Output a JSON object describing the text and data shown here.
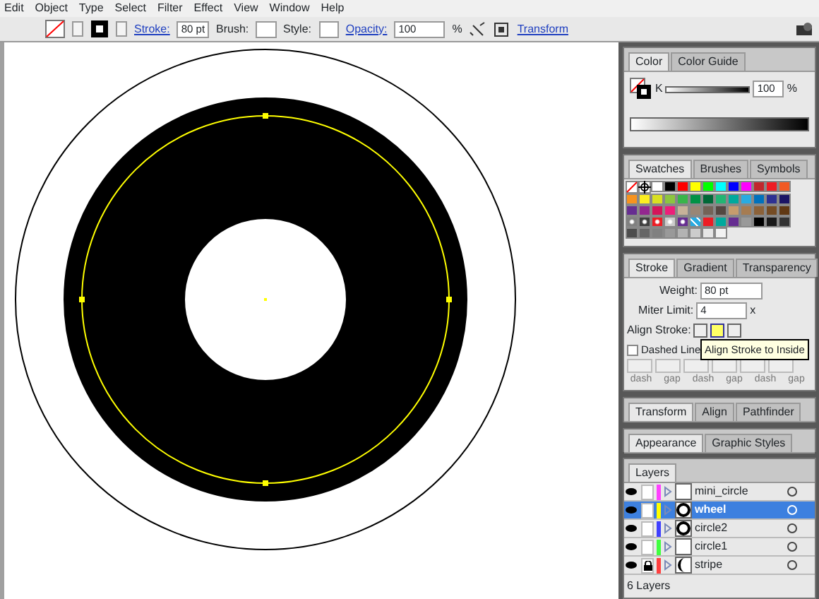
{
  "menu": [
    "Edit",
    "Object",
    "Type",
    "Select",
    "Filter",
    "Effect",
    "View",
    "Window",
    "Help"
  ],
  "control_bar": {
    "stroke_label": "Stroke:",
    "stroke_weight": "80 pt",
    "brush_label": "Brush:",
    "style_label": "Style:",
    "opacity_label": "Opacity:",
    "opacity": "100",
    "percent": "%",
    "transform": "Transform"
  },
  "color_panel": {
    "tabs": [
      {
        "label": "Color",
        "selected": true
      },
      {
        "label": "Color Guide",
        "selected": false
      }
    ],
    "channel": "K",
    "level": 1,
    "value": "100",
    "unit": "%"
  },
  "swatches_panel": {
    "tabs": [
      {
        "label": "Swatches",
        "selected": true
      },
      {
        "label": "Brushes",
        "selected": false
      },
      {
        "label": "Symbols",
        "selected": false
      }
    ],
    "swatches": [
      {
        "kind": "none"
      },
      {
        "kind": "registration"
      },
      {
        "kind": "color",
        "color": "#ffffff"
      },
      {
        "kind": "color",
        "color": "#000000"
      },
      {
        "kind": "color",
        "color": "#ff0000"
      },
      {
        "kind": "color",
        "color": "#ffff00"
      },
      {
        "kind": "color",
        "color": "#00ff00"
      },
      {
        "kind": "color",
        "color": "#00ffff"
      },
      {
        "kind": "color",
        "color": "#0000ff"
      },
      {
        "kind": "color",
        "color": "#ff00ff"
      },
      {
        "kind": "color",
        "color": "#c1272d"
      },
      {
        "kind": "color",
        "color": "#ed1c24"
      },
      {
        "kind": "color",
        "color": "#f15a24"
      },
      {
        "kind": "color",
        "color": "#f7931e"
      },
      {
        "kind": "color",
        "color": "#fcee21"
      },
      {
        "kind": "color",
        "color": "#d9e021"
      },
      {
        "kind": "color",
        "color": "#8cc63f"
      },
      {
        "kind": "color",
        "color": "#39b54a"
      },
      {
        "kind": "color",
        "color": "#009245"
      },
      {
        "kind": "color",
        "color": "#006837"
      },
      {
        "kind": "color",
        "color": "#22b573"
      },
      {
        "kind": "color",
        "color": "#00a99d"
      },
      {
        "kind": "color",
        "color": "#29abe2"
      },
      {
        "kind": "color",
        "color": "#0071bc"
      },
      {
        "kind": "color",
        "color": "#2e3192"
      },
      {
        "kind": "color",
        "color": "#1b1464"
      },
      {
        "kind": "color",
        "color": "#662d91"
      },
      {
        "kind": "color",
        "color": "#93278f"
      },
      {
        "kind": "color",
        "color": "#d4145a"
      },
      {
        "kind": "color",
        "color": "#ed1e79"
      },
      {
        "kind": "color",
        "color": "#c7b299"
      },
      {
        "kind": "color",
        "color": "#998675"
      },
      {
        "kind": "color",
        "color": "#736357"
      },
      {
        "kind": "color",
        "color": "#534741"
      },
      {
        "kind": "color",
        "color": "#c69c6d"
      },
      {
        "kind": "color",
        "color": "#a67c52"
      },
      {
        "kind": "color",
        "color": "#8c6239"
      },
      {
        "kind": "color",
        "color": "#754c24"
      },
      {
        "kind": "color",
        "color": "#603813"
      },
      {
        "kind": "gradient",
        "color": "#808080"
      },
      {
        "kind": "gradient",
        "color": "#404040"
      },
      {
        "kind": "gradient",
        "color": "#ed1c24"
      },
      {
        "kind": "gradient",
        "color": "#cccccc"
      },
      {
        "kind": "gradient",
        "color": "#662d91"
      },
      {
        "kind": "pattern",
        "color": "#29abe2"
      },
      {
        "kind": "color",
        "color": "#ed1c24"
      },
      {
        "kind": "color",
        "color": "#00a99d"
      },
      {
        "kind": "color",
        "color": "#662d91"
      },
      {
        "kind": "color",
        "color": "#999999"
      },
      {
        "kind": "color",
        "color": "#000000"
      },
      {
        "kind": "color",
        "color": "#1a1a1a"
      },
      {
        "kind": "color",
        "color": "#333333"
      },
      {
        "kind": "color",
        "color": "#4d4d4d"
      },
      {
        "kind": "color",
        "color": "#666666"
      },
      {
        "kind": "color",
        "color": "#808080"
      },
      {
        "kind": "color",
        "color": "#999999"
      },
      {
        "kind": "color",
        "color": "#b3b3b3"
      },
      {
        "kind": "color",
        "color": "#cccccc"
      },
      {
        "kind": "color",
        "color": "#e6e6e6"
      },
      {
        "kind": "color",
        "color": "#f2f2f2"
      }
    ]
  },
  "stroke_panel": {
    "tabs": [
      {
        "label": "Stroke",
        "selected": true
      },
      {
        "label": "Gradient",
        "selected": false
      },
      {
        "label": "Transparency",
        "selected": false
      }
    ],
    "weight_label": "Weight:",
    "weight": "80 pt",
    "miter_label": "Miter Limit:",
    "miter": "4",
    "miter_unit": "x",
    "align_label": "Align Stroke:",
    "align_buttons": [
      {
        "selected": false
      },
      {
        "selected": true
      },
      {
        "selected": false
      }
    ],
    "dashed": {
      "label": "Dashed Line",
      "checked": false
    },
    "dash_labels": [
      "dash",
      "gap",
      "dash",
      "gap",
      "dash",
      "gap"
    ],
    "tooltip": "Align Stroke to Inside"
  },
  "transform_panel": {
    "tabs": [
      {
        "label": "Transform",
        "selected": true
      },
      {
        "label": "Align",
        "selected": false
      },
      {
        "label": "Pathfinder",
        "selected": false
      }
    ]
  },
  "appearance_panel": {
    "tabs": [
      {
        "label": "Appearance",
        "selected": true
      },
      {
        "label": "Graphic Styles",
        "selected": false
      }
    ]
  },
  "layers_panel": {
    "tabs": [
      {
        "label": "Layers",
        "selected": true
      }
    ],
    "layers": [
      {
        "name": "mini_circle",
        "color": "#ff40ff",
        "selected": false,
        "locked": false,
        "kind": "blank"
      },
      {
        "name": "wheel",
        "color": "#ffff00",
        "selected": true,
        "locked": false,
        "kind": "ring"
      },
      {
        "name": "circle2",
        "color": "#4040ff",
        "selected": false,
        "locked": false,
        "kind": "ring"
      },
      {
        "name": "circle1",
        "color": "#40ff40",
        "selected": false,
        "locked": false,
        "kind": "blank"
      },
      {
        "name": "stripe",
        "color": "#ff4040",
        "selected": false,
        "locked": true,
        "kind": "crescent"
      }
    ],
    "count": "6 Layers"
  }
}
